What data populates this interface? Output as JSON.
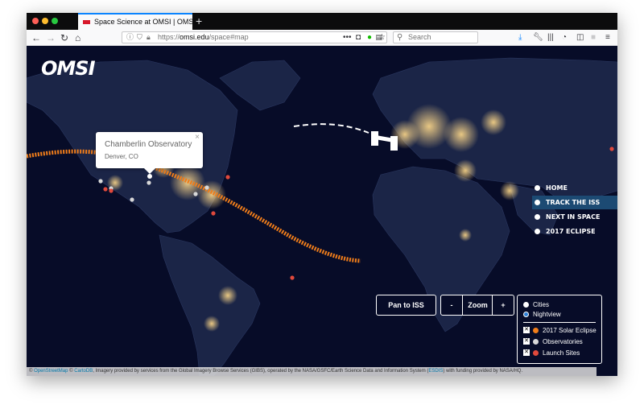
{
  "browser": {
    "tab_title": "Space Science at OMSI | OMSI",
    "new_tab": "+",
    "url_scheme": "https://",
    "url_host": "omsi.edu",
    "url_path": "/space#map",
    "search_placeholder": "Search",
    "icons": [
      "back-icon",
      "forward-icon",
      "reload-icon",
      "home-icon",
      "info-icon",
      "shield-icon",
      "lock-icon",
      "reader-icon",
      "more-icon",
      "pocket-icon",
      "star-icon",
      "download-icon",
      "wrench-icon",
      "library-icon",
      "sidebar-icon",
      "menu-icon"
    ]
  },
  "map": {
    "logo": "OMSI",
    "popup": {
      "title": "Chamberlin Observatory",
      "subtitle": "Denver, CO",
      "close": "×"
    },
    "nav": [
      {
        "label": "HOME",
        "active": false
      },
      {
        "label": "TRACK THE ISS",
        "active": true
      },
      {
        "label": "NEXT IN SPACE",
        "active": false
      },
      {
        "label": "2017 ECLIPSE",
        "active": false
      }
    ],
    "controls": {
      "pan_label": "Pan to ISS",
      "zoom_minus": "-",
      "zoom_label": "Zoom",
      "zoom_plus": "+"
    },
    "legend": {
      "base_layers": [
        {
          "label": "Cities",
          "selected": false
        },
        {
          "label": "Nightview",
          "selected": true
        }
      ],
      "overlays": [
        {
          "label": "2017 Solar Eclipse",
          "checked": true,
          "color": "#f07d1a"
        },
        {
          "label": "Observatories",
          "checked": true,
          "color": "#d8d8d8"
        },
        {
          "label": "Launch Sites",
          "checked": true,
          "color": "#e0493c"
        }
      ]
    },
    "attribution": {
      "copy1": "©",
      "osm": "OpenStreetMap",
      "copy2": "©",
      "carto": "CartoDB",
      "text1": ", Imagery provided by services from the Global Imagery Browse Services (GIBS), operated by the NASA/GSFC/Earth Science Data and Information System (",
      "esdis": "ESDIS",
      "text2": ") with funding provided by NASA/HQ."
    }
  }
}
